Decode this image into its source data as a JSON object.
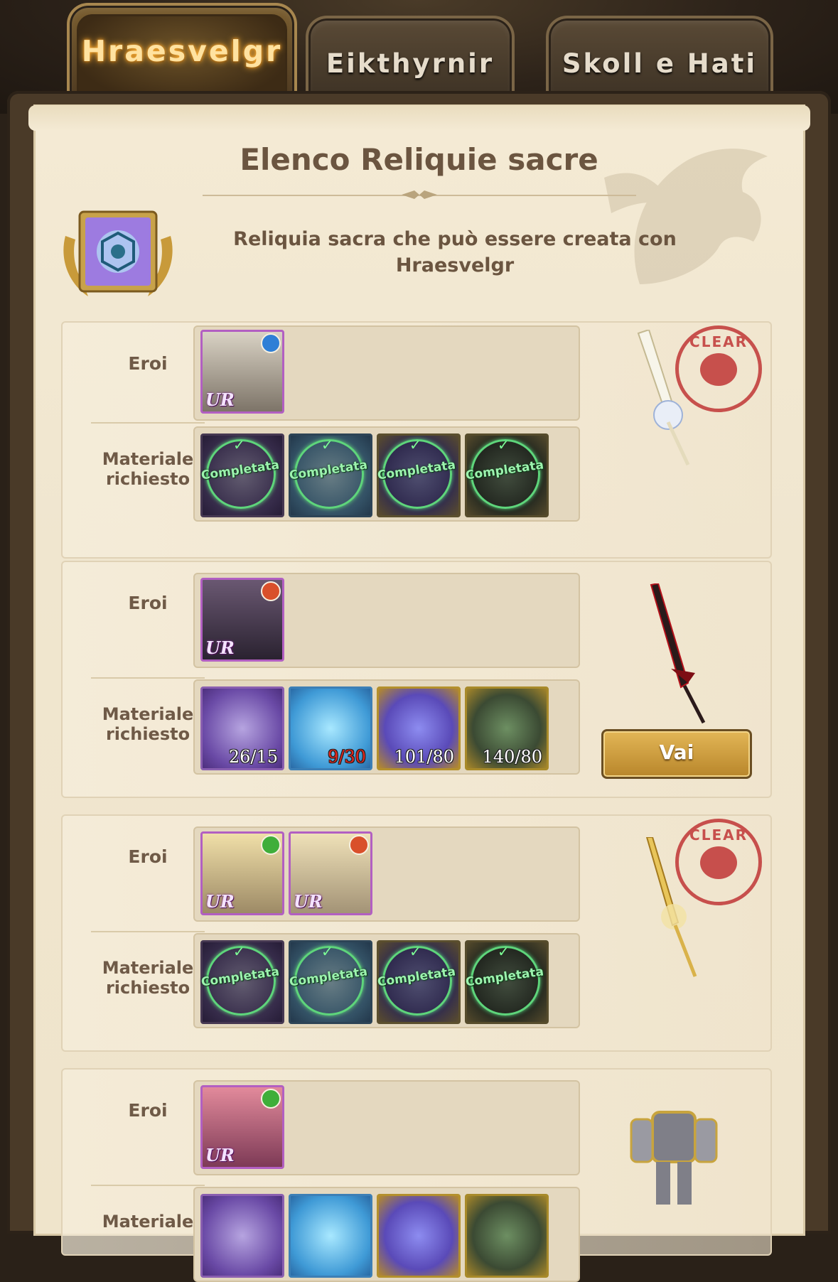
{
  "tabs": [
    {
      "label": "Hraesvelgr",
      "active": true
    },
    {
      "label": "Eikthyrnir",
      "active": false
    },
    {
      "label": "Skoll e Hati",
      "active": false
    }
  ],
  "header": {
    "title": "Elenco Reliquie sacre",
    "subtitle_line1": "Reliquia sacra che può essere creata con",
    "subtitle_line2": "Hraesvelgr"
  },
  "labels": {
    "heroes": "Eroi",
    "materials_line1": "Materiale",
    "materials_line2": "richiesto",
    "completed": "Completata",
    "go_button": "Vai",
    "stamp": "CLEAR"
  },
  "entries": [
    {
      "status": "clear",
      "weapon": "white-sword"
    },
    {
      "status": "in-progress",
      "weapon": "dark-sword",
      "materials": [
        {
          "have": "26",
          "req": "15",
          "short": false
        },
        {
          "have": "9",
          "req": "30",
          "short": true
        },
        {
          "have": "101",
          "req": "80",
          "short": false
        },
        {
          "have": "140",
          "req": "80",
          "short": false
        }
      ]
    },
    {
      "status": "clear",
      "weapon": "gold-spear"
    },
    {
      "status": "locked",
      "weapon": "armor"
    }
  ],
  "colors": {
    "accent_green": "#5ed57b",
    "short_red": "#e2241c",
    "stamp_red": "#c03636",
    "button_gold": "#d6a544"
  }
}
